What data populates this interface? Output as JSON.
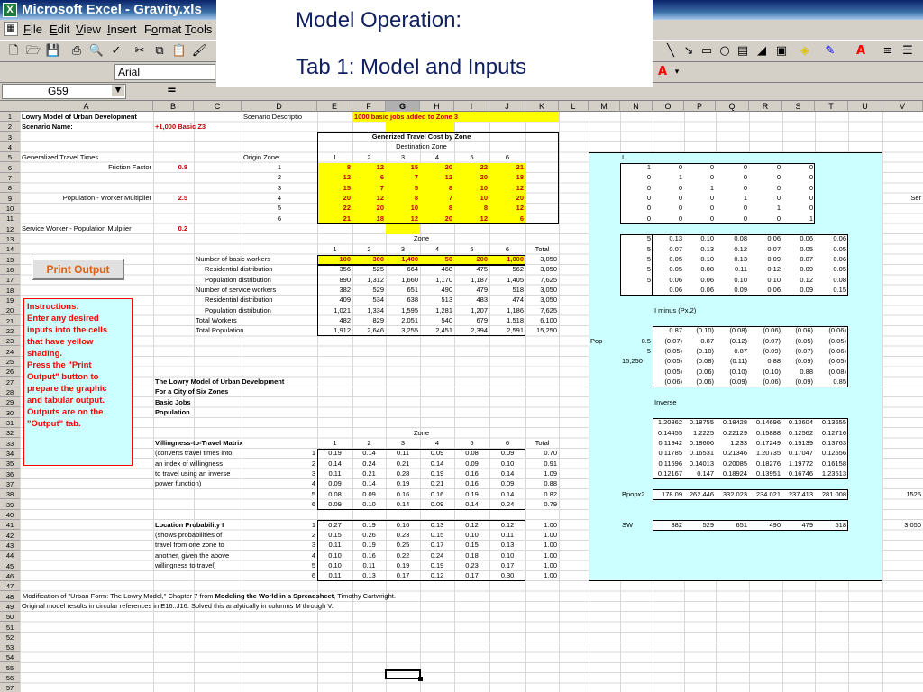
{
  "window": {
    "title": "Microsoft Excel - Gravity.xls",
    "icon": "excel-icon"
  },
  "menu": [
    {
      "first": "F",
      "rest": "ile"
    },
    {
      "first": "E",
      "rest": "dit"
    },
    {
      "first": "V",
      "rest": "iew"
    },
    {
      "first": "I",
      "rest": "nsert"
    },
    {
      "pre": "F",
      "first": "o",
      "rest": "rmat"
    },
    {
      "first": "T",
      "rest": "ools"
    }
  ],
  "toolbar": {
    "font": "Arial",
    "font_color_label": "A"
  },
  "formula_bar": {
    "name_box": "G59",
    "equals": "="
  },
  "overlay": {
    "line1": "Model Operation:",
    "line2": "Tab 1:  Model and Inputs"
  },
  "columns": [
    "A",
    "B",
    "C",
    "D",
    "E",
    "F",
    "G",
    "H",
    "I",
    "J",
    "K",
    "L",
    "M",
    "N",
    "O",
    "P",
    "Q",
    "R",
    "S",
    "T",
    "U",
    "V"
  ],
  "rows": [
    "1",
    "2",
    "3",
    "4",
    "5",
    "6",
    "7",
    "8",
    "9",
    "10",
    "11",
    "12",
    "13",
    "14",
    "15",
    "16",
    "17",
    "18",
    "19",
    "20",
    "21",
    "22",
    "23",
    "24",
    "25",
    "26",
    "27",
    "28",
    "29",
    "30",
    "31",
    "32",
    "33",
    "34",
    "35",
    "36",
    "37",
    "38",
    "39",
    "40",
    "41",
    "42",
    "43",
    "44",
    "45",
    "46",
    "47",
    "48",
    "49",
    "50",
    "51",
    "52",
    "53",
    "54",
    "55",
    "56",
    "57",
    "58",
    "59",
    "60"
  ],
  "sheet": {
    "title": "Lowry Model of Urban Development",
    "scenario_desc_label": "Scenario Descriptio",
    "scenario_desc": "1000 basic jobs added to Zone 3",
    "scenario_name_label": "Scenario Name:",
    "scenario_name": "+1,000 Basic Z3",
    "gen_travel_title": "Generized Travel Cost by Zone",
    "destination_zone": "Destination Zone",
    "gen_travel_times": "Generalized Travel Times",
    "origin_zone": "Origin Zone",
    "friction_label": "Friction Factor",
    "friction_value": "0.8",
    "pop_worker_label": "Population - Worker Multiplier",
    "pop_worker_value": "2.5",
    "service_label": "Service Worker - Population Mulplier",
    "service_value": "0.2",
    "zone_headers": [
      "1",
      "2",
      "3",
      "4",
      "5",
      "6"
    ],
    "origin_zones": [
      "1",
      "2",
      "3",
      "4",
      "5",
      "6"
    ],
    "travel_costs": [
      [
        "8",
        "12",
        "15",
        "20",
        "22",
        "21"
      ],
      [
        "12",
        "6",
        "7",
        "12",
        "20",
        "18"
      ],
      [
        "15",
        "7",
        "5",
        "8",
        "10",
        "12"
      ],
      [
        "20",
        "12",
        "8",
        "7",
        "10",
        "20"
      ],
      [
        "22",
        "20",
        "10",
        "8",
        "8",
        "12"
      ],
      [
        "21",
        "18",
        "12",
        "20",
        "12",
        "6"
      ]
    ],
    "zone_label": "Zone",
    "total_label": "Total",
    "workers_table": [
      {
        "label": "Number of basic workers",
        "values": [
          "100",
          "300",
          "1,400",
          "50",
          "200",
          "1,000"
        ],
        "total": "3,050"
      },
      {
        "label": "Residential distribution",
        "values": [
          "356",
          "525",
          "664",
          "468",
          "475",
          "562"
        ],
        "total": "3,050"
      },
      {
        "label": "Population distribution",
        "values": [
          "890",
          "1,312",
          "1,660",
          "1,170",
          "1,187",
          "1,405"
        ],
        "total": "7,625"
      },
      {
        "label": "Number of service workers",
        "values": [
          "382",
          "529",
          "651",
          "490",
          "479",
          "518"
        ],
        "total": "3,050"
      },
      {
        "label": "Residential distribution",
        "values": [
          "409",
          "534",
          "638",
          "513",
          "483",
          "474"
        ],
        "total": "3,050"
      },
      {
        "label": "Population distribution",
        "values": [
          "1,021",
          "1,334",
          "1,595",
          "1,281",
          "1,207",
          "1,186"
        ],
        "total": "7,625"
      },
      {
        "label": "Total Workers",
        "values": [
          "482",
          "829",
          "2,051",
          "540",
          "679",
          "1,518"
        ],
        "total": "6,100"
      },
      {
        "label": "Total Population",
        "values": [
          "1,912",
          "2,646",
          "3,255",
          "2,451",
          "2,394",
          "2,591"
        ],
        "total": "15,250"
      }
    ],
    "print_button": "Print Output",
    "instructions": [
      "Instructions:",
      "Enter any desired",
      "inputs into the cells",
      "that have yellow",
      "shading.",
      "Press the \"Print",
      "Output\" button to",
      "prepare the graphic",
      "and tabular output.",
      "Outputs are on the",
      "\"Output\" tab."
    ],
    "model_title": [
      "The Lowry Model of Urban Development",
      "For a City of Six Zones",
      "Basic Jobs",
      "Population"
    ],
    "willingness_title": "Villingness-to-Travel Matrix",
    "willingness_desc": [
      "(converts travel times into",
      "an index of willingness",
      "to travel using an inverse",
      "power function)",
      "",
      ""
    ],
    "willingness": [
      [
        "0.19",
        "0.14",
        "0.11",
        "0.09",
        "0.08",
        "0.09"
      ],
      [
        "0.14",
        "0.24",
        "0.21",
        "0.14",
        "0.09",
        "0.10"
      ],
      [
        "0.11",
        "0.21",
        "0.28",
        "0.19",
        "0.16",
        "0.14"
      ],
      [
        "0.09",
        "0.14",
        "0.19",
        "0.21",
        "0.16",
        "0.09"
      ],
      [
        "0.08",
        "0.09",
        "0.16",
        "0.16",
        "0.19",
        "0.14"
      ],
      [
        "0.09",
        "0.10",
        "0.14",
        "0.09",
        "0.14",
        "0.24"
      ]
    ],
    "willingness_totals": [
      "0.70",
      "0.91",
      "1.09",
      "0.88",
      "0.82",
      "0.79"
    ],
    "location_title": "Location Probability I",
    "location_desc": [
      "(shows probabilities of",
      "travel from one zone to",
      "another, given the above",
      "willingness to travel)",
      "",
      ""
    ],
    "location": [
      [
        "0.27",
        "0.19",
        "0.16",
        "0.13",
        "0.12",
        "0.12"
      ],
      [
        "0.15",
        "0.26",
        "0.23",
        "0.15",
        "0.10",
        "0.11"
      ],
      [
        "0.11",
        "0.19",
        "0.25",
        "0.17",
        "0.15",
        "0.13"
      ],
      [
        "0.10",
        "0.16",
        "0.22",
        "0.24",
        "0.18",
        "0.10"
      ],
      [
        "0.10",
        "0.11",
        "0.19",
        "0.19",
        "0.23",
        "0.17"
      ],
      [
        "0.11",
        "0.13",
        "0.17",
        "0.12",
        "0.17",
        "0.30"
      ]
    ],
    "location_totals": [
      "1.00",
      "1.00",
      "1.00",
      "1.00",
      "1.00",
      "1.00"
    ],
    "footnote1_a": "Modification of \"Urban Form: The Lowry Model,\" Chapter 7 from ",
    "footnote1_b": "Modeling the World in a Spreadsheet",
    "footnote1_c": ", Timothy Cartwright.",
    "footnote2": "Original model results in circular references in E16..J16.  Solved this analytically in columns M through V."
  },
  "side": {
    "i_label": "I",
    "identity": [
      [
        "1",
        "0",
        "0",
        "0",
        "0",
        "0"
      ],
      [
        "0",
        "1",
        "0",
        "0",
        "0",
        "0"
      ],
      [
        "0",
        "0",
        "1",
        "0",
        "0",
        "0"
      ],
      [
        "0",
        "0",
        "0",
        "1",
        "0",
        "0"
      ],
      [
        "0",
        "0",
        "0",
        "0",
        "1",
        "0"
      ],
      [
        "0",
        "0",
        "0",
        "0",
        "0",
        "1"
      ]
    ],
    "p_col": [
      "5",
      "5",
      "5",
      "5",
      "5"
    ],
    "p_matrix": [
      [
        "0.13",
        "0.10",
        "0.08",
        "0.06",
        "0.06",
        "0.06"
      ],
      [
        "0.07",
        "0.13",
        "0.12",
        "0.07",
        "0.05",
        "0.05"
      ],
      [
        "0.05",
        "0.10",
        "0.13",
        "0.09",
        "0.07",
        "0.06"
      ],
      [
        "0.05",
        "0.08",
        "0.11",
        "0.12",
        "0.09",
        "0.05"
      ],
      [
        "0.06",
        "0.06",
        "0.10",
        "0.10",
        "0.12",
        "0.08"
      ],
      [
        "0.06",
        "0.06",
        "0.09",
        "0.06",
        "0.09",
        "0.15"
      ]
    ],
    "i_minus_label": "I minus (Px.2)",
    "i_minus": [
      [
        "0.87",
        "(0.10)",
        "(0.08)",
        "(0.06)",
        "(0.06)",
        "(0.06)"
      ],
      [
        "(0.07)",
        "0.87",
        "(0.12)",
        "(0.07)",
        "(0.05)",
        "(0.05)"
      ],
      [
        "(0.05)",
        "(0.10)",
        "0.87",
        "(0.09)",
        "(0.07)",
        "(0.06)"
      ],
      [
        "(0.05)",
        "(0.08)",
        "(0.11)",
        "0.88",
        "(0.09)",
        "(0.05)"
      ],
      [
        "(0.05)",
        "(0.06)",
        "(0.10)",
        "(0.10)",
        "0.88",
        "(0.08)"
      ],
      [
        "(0.06)",
        "(0.06)",
        "(0.09)",
        "(0.06)",
        "(0.09)",
        "0.85"
      ]
    ],
    "pop_label": "Pop",
    "pop_values": [
      "0.5",
      "5",
      "15,250"
    ],
    "inverse_label": "Inverse",
    "inverse": [
      [
        "1.20862",
        "0.18755",
        "0.18428",
        "0.14696",
        "0.13604",
        "0.13655"
      ],
      [
        "0.14455",
        "1.2225",
        "0.22129",
        "0.15888",
        "0.12562",
        "0.12716"
      ],
      [
        "0.11942",
        "0.18606",
        "1.233",
        "0.17249",
        "0.15139",
        "0.13763"
      ],
      [
        "0.11785",
        "0.16531",
        "0.21346",
        "1.20735",
        "0.17047",
        "0.12556"
      ],
      [
        "0.11696",
        "0.14013",
        "0.20085",
        "0.18276",
        "1.19772",
        "0.16158"
      ],
      [
        "0.12167",
        "0.147",
        "0.18924",
        "0.13951",
        "0.16746",
        "1.23513"
      ]
    ],
    "bpop_label": "Bpopx2",
    "bpop": [
      "178.09",
      "262.446",
      "332.023",
      "234.021",
      "237.413",
      "281.008"
    ],
    "bpop_right": "1525",
    "sw_label": "SW",
    "sw": [
      "382",
      "529",
      "651",
      "490",
      "479",
      "518"
    ],
    "sw_total": "3,050",
    "ser_cut": "Ser"
  },
  "colors": {
    "yellow": "#ffff00",
    "cyan": "#ccffff",
    "red_text": "#ff0000",
    "title_gradient": "#0a246a"
  }
}
